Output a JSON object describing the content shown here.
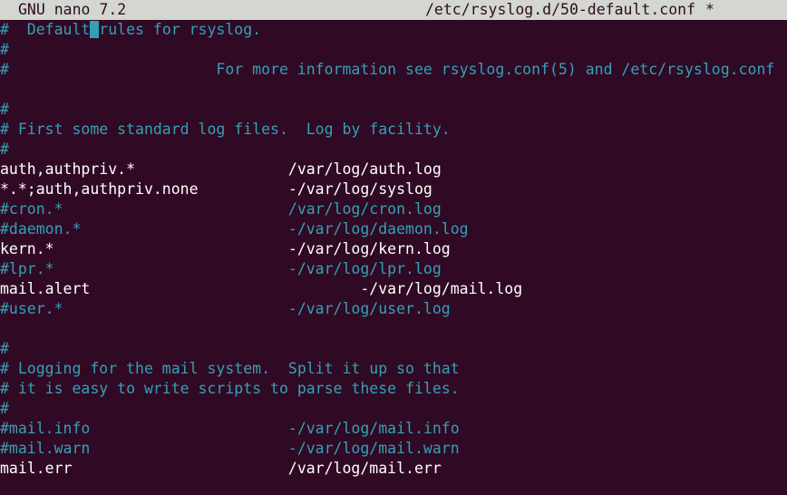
{
  "titlebar": {
    "app": "GNU nano 7.2",
    "filename": "/etc/rsyslog.d/50-default.conf",
    "modified": "*"
  },
  "lines": [
    {
      "type": "comment-cursor",
      "pre": "#  Default",
      "cursor": " ",
      "post": "rules for rsyslog."
    },
    {
      "type": "comment",
      "text": "#"
    },
    {
      "type": "comment",
      "text": "#                       For more information see rsyslog.conf(5) and /etc/rsyslog.conf"
    },
    {
      "type": "blank",
      "text": ""
    },
    {
      "type": "comment",
      "text": "#"
    },
    {
      "type": "comment",
      "text": "# First some standard log files.  Log by facility."
    },
    {
      "type": "comment",
      "text": "#"
    },
    {
      "type": "normal",
      "text": "auth,authpriv.*                 /var/log/auth.log"
    },
    {
      "type": "normal",
      "text": "*.*;auth,authpriv.none          -/var/log/syslog"
    },
    {
      "type": "comment",
      "text": "#cron.*                         /var/log/cron.log"
    },
    {
      "type": "comment",
      "text": "#daemon.*                       -/var/log/daemon.log"
    },
    {
      "type": "normal",
      "text": "kern.*                          -/var/log/kern.log"
    },
    {
      "type": "comment",
      "text": "#lpr.*                          -/var/log/lpr.log"
    },
    {
      "type": "normal",
      "text": "mail.alert                              -/var/log/mail.log"
    },
    {
      "type": "comment",
      "text": "#user.*                         -/var/log/user.log"
    },
    {
      "type": "blank",
      "text": ""
    },
    {
      "type": "comment",
      "text": "#"
    },
    {
      "type": "comment",
      "text": "# Logging for the mail system.  Split it up so that"
    },
    {
      "type": "comment",
      "text": "# it is easy to write scripts to parse these files."
    },
    {
      "type": "comment",
      "text": "#"
    },
    {
      "type": "comment",
      "text": "#mail.info                      -/var/log/mail.info"
    },
    {
      "type": "comment",
      "text": "#mail.warn                      -/var/log/mail.warn"
    },
    {
      "type": "normal",
      "text": "mail.err                        /var/log/mail.err"
    },
    {
      "type": "blank",
      "text": ""
    }
  ],
  "colors": {
    "background": "#300a24",
    "titlebar": "#d3d7cf",
    "comment": "#34a0b8",
    "text": "#ffffff",
    "cursor": "#34a0b8"
  }
}
